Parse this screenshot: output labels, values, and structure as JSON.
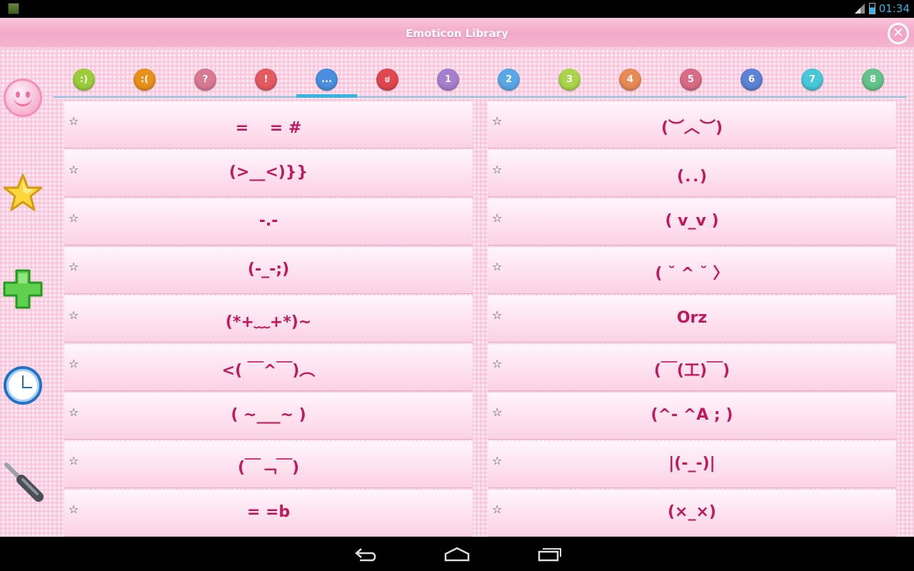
{
  "status_bar": {
    "time": "01:34"
  },
  "app": {
    "title": "Emoticon Library"
  },
  "sidebar": [
    {
      "id": "smiley",
      "icon": "smiley-icon"
    },
    {
      "id": "favorites",
      "icon": "star-icon"
    },
    {
      "id": "add",
      "icon": "plus-icon"
    },
    {
      "id": "recent",
      "icon": "clock-icon"
    },
    {
      "id": "settings",
      "icon": "screwdriver-icon"
    }
  ],
  "tabs": [
    {
      "label": ":)",
      "color": "#9ccc3a"
    },
    {
      "label": ":(",
      "color": "#e8901a"
    },
    {
      "label": "?",
      "color": "#d97a93"
    },
    {
      "label": "!",
      "color": "#e45a63"
    },
    {
      "label": "...",
      "color": "#4a8ee0",
      "active": true
    },
    {
      "label": "ಠ",
      "color": "#e0474f"
    },
    {
      "label": "1",
      "color": "#a77fd0"
    },
    {
      "label": "2",
      "color": "#58a8e8"
    },
    {
      "label": "3",
      "color": "#a9d44b"
    },
    {
      "label": "4",
      "color": "#e88a56"
    },
    {
      "label": "5",
      "color": "#d96b87"
    },
    {
      "label": "6",
      "color": "#5b82d6"
    },
    {
      "label": "7",
      "color": "#48c7d9"
    },
    {
      "label": "8",
      "color": "#62c48a"
    }
  ],
  "left_column": [
    "=　 = #",
    "(>__<)}}",
    "-.-",
    "(-_-;)",
    "(*+﹏+*)~",
    "<( ￣^￣)︵",
    "( ~___~ )",
    "(￣﹁￣)",
    "= =b"
  ],
  "right_column": [
    "(︶︿︶)",
    "(．．)",
    "( v_v )",
    "( ˘ ^ ˘ 〉",
    "Orz",
    "(￣(工)￣)",
    "(^- ^A ; )",
    "|(-_-)|",
    "(×_×)"
  ],
  "colors": {
    "accent": "#33b5e5",
    "emoticon_text": "#c2185b",
    "title_bar": "#f3a9c7"
  }
}
